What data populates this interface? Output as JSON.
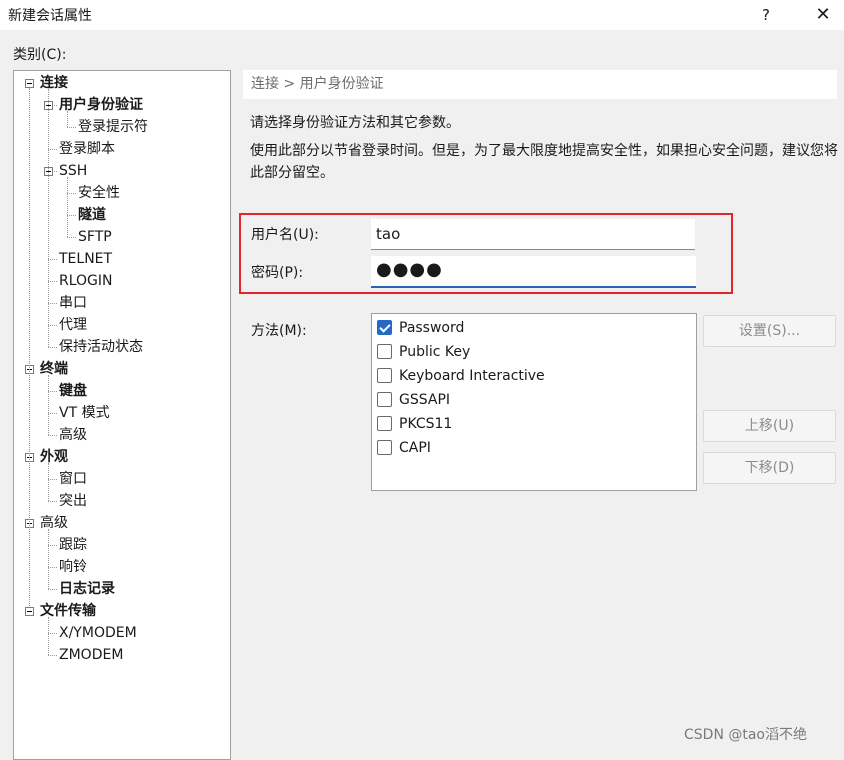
{
  "window": {
    "title": "新建会话属性",
    "help_label": "?",
    "close_label": "✕"
  },
  "category_label": "类别(C):",
  "tree": {
    "items": [
      {
        "label": "连接",
        "bold": true,
        "level": 0,
        "expander": true
      },
      {
        "label": "用户身份验证",
        "bold": true,
        "level": 1,
        "expander": true
      },
      {
        "label": "登录提示符",
        "bold": false,
        "level": 2
      },
      {
        "label": "登录脚本",
        "bold": false,
        "level": 1
      },
      {
        "label": "SSH",
        "bold": false,
        "level": 1,
        "expander": true
      },
      {
        "label": "安全性",
        "bold": false,
        "level": 2
      },
      {
        "label": "隧道",
        "bold": true,
        "level": 2
      },
      {
        "label": "SFTP",
        "bold": false,
        "level": 2
      },
      {
        "label": "TELNET",
        "bold": false,
        "level": 1
      },
      {
        "label": "RLOGIN",
        "bold": false,
        "level": 1
      },
      {
        "label": "串口",
        "bold": false,
        "level": 1
      },
      {
        "label": "代理",
        "bold": false,
        "level": 1
      },
      {
        "label": "保持活动状态",
        "bold": false,
        "level": 1
      },
      {
        "label": "终端",
        "bold": true,
        "level": 0,
        "expander": true
      },
      {
        "label": "键盘",
        "bold": true,
        "level": 1
      },
      {
        "label": "VT 模式",
        "bold": false,
        "level": 1
      },
      {
        "label": "高级",
        "bold": false,
        "level": 1
      },
      {
        "label": "外观",
        "bold": true,
        "level": 0,
        "expander": true
      },
      {
        "label": "窗口",
        "bold": false,
        "level": 1
      },
      {
        "label": "突出",
        "bold": false,
        "level": 1
      },
      {
        "label": "高级",
        "bold": false,
        "level": 0,
        "expander": true
      },
      {
        "label": "跟踪",
        "bold": false,
        "level": 1
      },
      {
        "label": "响铃",
        "bold": false,
        "level": 1
      },
      {
        "label": "日志记录",
        "bold": true,
        "level": 1
      },
      {
        "label": "文件传输",
        "bold": true,
        "level": 0,
        "expander": true
      },
      {
        "label": "X/YMODEM",
        "bold": false,
        "level": 1
      },
      {
        "label": "ZMODEM",
        "bold": false,
        "level": 1
      }
    ]
  },
  "breadcrumb": "连接 > 用户身份验证",
  "description": {
    "line1": "请选择身份验证方法和其它参数。",
    "line2": "使用此部分以节省登录时间。但是，为了最大限度地提高安全性，如果担心安全问题，建议您将此部分留空。"
  },
  "form": {
    "username_label": "用户名(U):",
    "username_value": "tao",
    "password_label": "密码(P):",
    "password_value": "●●●●",
    "method_label": "方法(M):"
  },
  "methods": [
    {
      "label": "Password",
      "checked": true
    },
    {
      "label": "Public Key",
      "checked": false
    },
    {
      "label": "Keyboard Interactive",
      "checked": false
    },
    {
      "label": "GSSAPI",
      "checked": false
    },
    {
      "label": "PKCS11",
      "checked": false
    },
    {
      "label": "CAPI",
      "checked": false
    }
  ],
  "buttons": {
    "settings": "设置(S)...",
    "move_up": "上移(U)",
    "move_down": "下移(D)"
  },
  "watermark": "CSDN @tao滔不绝",
  "colors": {
    "highlight_border": "#e0272b",
    "checkbox_checked": "#2569c4",
    "focus_underline": "#2a63b8"
  }
}
